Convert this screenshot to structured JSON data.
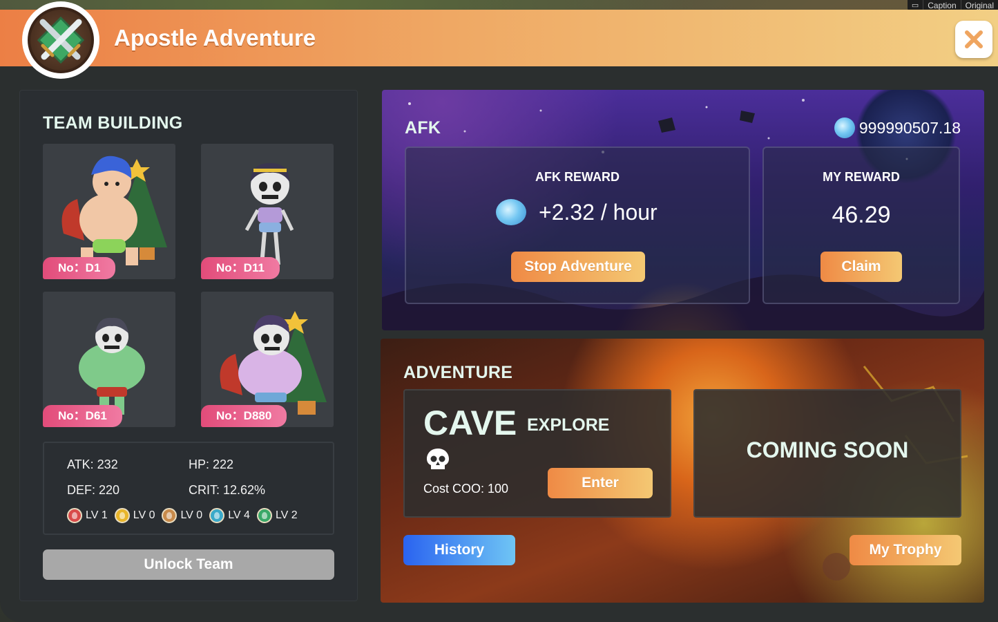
{
  "system_bar": {
    "caption": "Caption",
    "original": "Original"
  },
  "header": {
    "title": "Apostle Adventure"
  },
  "team": {
    "title": "TEAM BUILDING",
    "heroes": [
      {
        "tag": "No：D1"
      },
      {
        "tag": "No：D11"
      },
      {
        "tag": "No：D61"
      },
      {
        "tag": "No：D880"
      }
    ],
    "stats": {
      "atk": "ATK: 232",
      "hp": "HP: 222",
      "def": "DEF: 220",
      "crit": "CRIT: 12.62%"
    },
    "levels": [
      {
        "label": "LV 1",
        "color": "#d84a4a"
      },
      {
        "label": "LV 0",
        "color": "#e8b52a"
      },
      {
        "label": "LV 0",
        "color": "#c88a4a"
      },
      {
        "label": "LV 4",
        "color": "#3aa9c9"
      },
      {
        "label": "LV 2",
        "color": "#3aa868"
      }
    ],
    "unlock_label": "Unlock Team"
  },
  "afk": {
    "title": "AFK",
    "balance": "999990507.18",
    "afk_reward_label": "AFK REWARD",
    "afk_rate": "+2.32 / hour",
    "stop_label": "Stop Adventure",
    "my_reward_label": "MY REWARD",
    "my_reward_value": "46.29",
    "claim_label": "Claim"
  },
  "adventure": {
    "title": "ADVENTURE",
    "cave_name": "CAVE",
    "cave_mode": "EXPLORE",
    "cave_cost": "Cost COO: 100",
    "enter_label": "Enter",
    "coming_soon": "COMING SOON",
    "history_label": "History",
    "trophy_label": "My Trophy"
  },
  "colors": {
    "header_start": "#ec7f45",
    "header_end": "#f2cf84",
    "tag_pink": "#e24c7a",
    "button_orange": "#ef8a45",
    "button_blue": "#2a63f0"
  }
}
